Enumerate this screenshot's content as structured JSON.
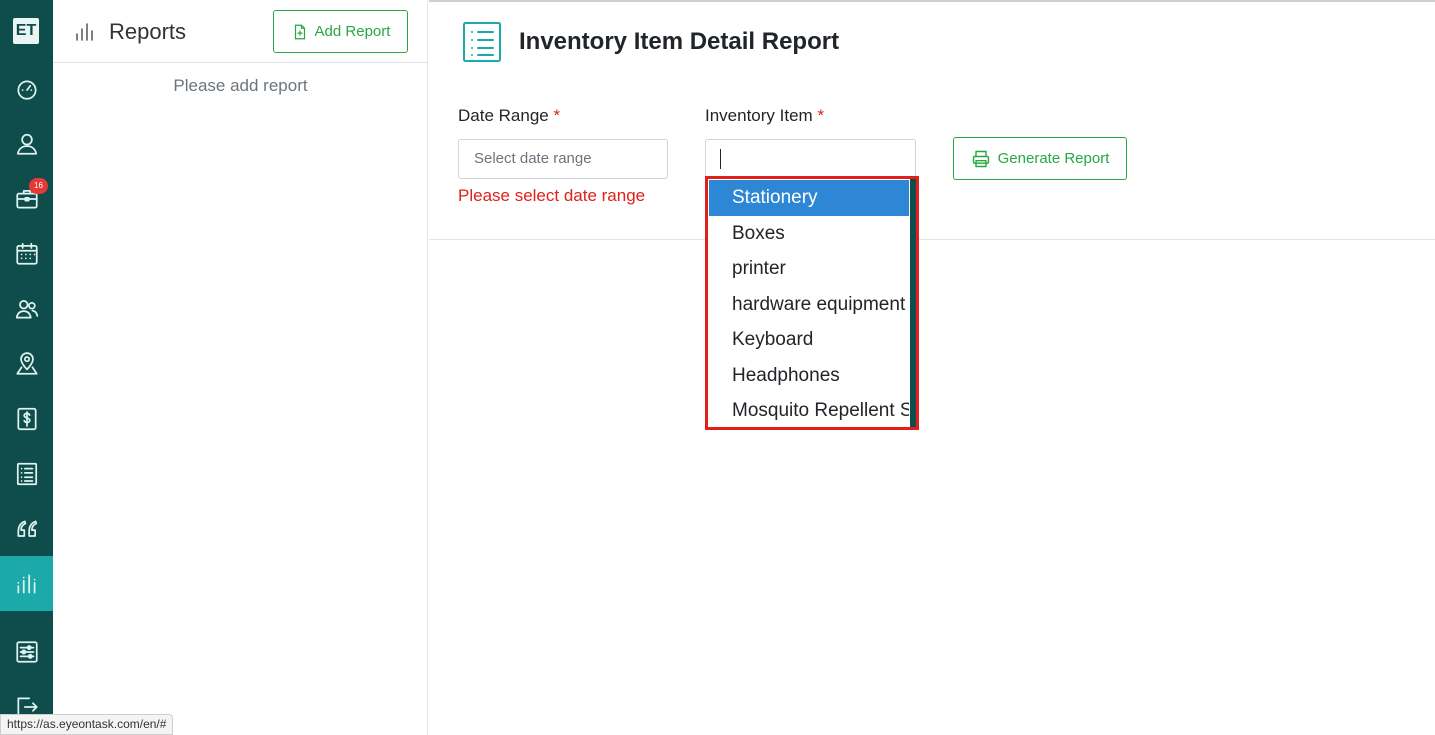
{
  "app": {
    "logo_text": "ET",
    "notification_count": "16"
  },
  "rail": {
    "items": [
      {
        "name": "dashboard-icon"
      },
      {
        "name": "user-icon"
      },
      {
        "name": "briefcase-icon"
      },
      {
        "name": "calendar-icon"
      },
      {
        "name": "team-icon"
      },
      {
        "name": "location-icon"
      },
      {
        "name": "dollar-icon"
      },
      {
        "name": "list-icon"
      },
      {
        "name": "quote-icon"
      },
      {
        "name": "reports-icon",
        "active": true
      },
      {
        "name": "settings-icon"
      },
      {
        "name": "logout-icon"
      }
    ],
    "active_color": "#1ba9a9",
    "background_color": "#0f4c4c"
  },
  "panel": {
    "title": "Reports",
    "add_button_label": "Add Report",
    "empty_message": "Please add report"
  },
  "main": {
    "title": "Inventory Item Detail Report",
    "date_range": {
      "label": "Date Range",
      "required_mark": "*",
      "placeholder": "Select date range",
      "error": "Please select date range"
    },
    "inventory_item": {
      "label": "Inventory Item",
      "required_mark": "*",
      "value": "",
      "options": [
        "Stationery",
        "Boxes",
        "printer",
        "hardware equipment",
        "Keyboard",
        "Headphones",
        "Mosquito Repellent Spray"
      ],
      "highlighted_option": "Stationery"
    },
    "generate_button_label": "Generate Report"
  },
  "status_bar": {
    "url": "https://as.eyeontask.com/en/#"
  },
  "colors": {
    "accent": "#28a745",
    "error": "#e0201b",
    "highlight": "#2e87d4"
  }
}
